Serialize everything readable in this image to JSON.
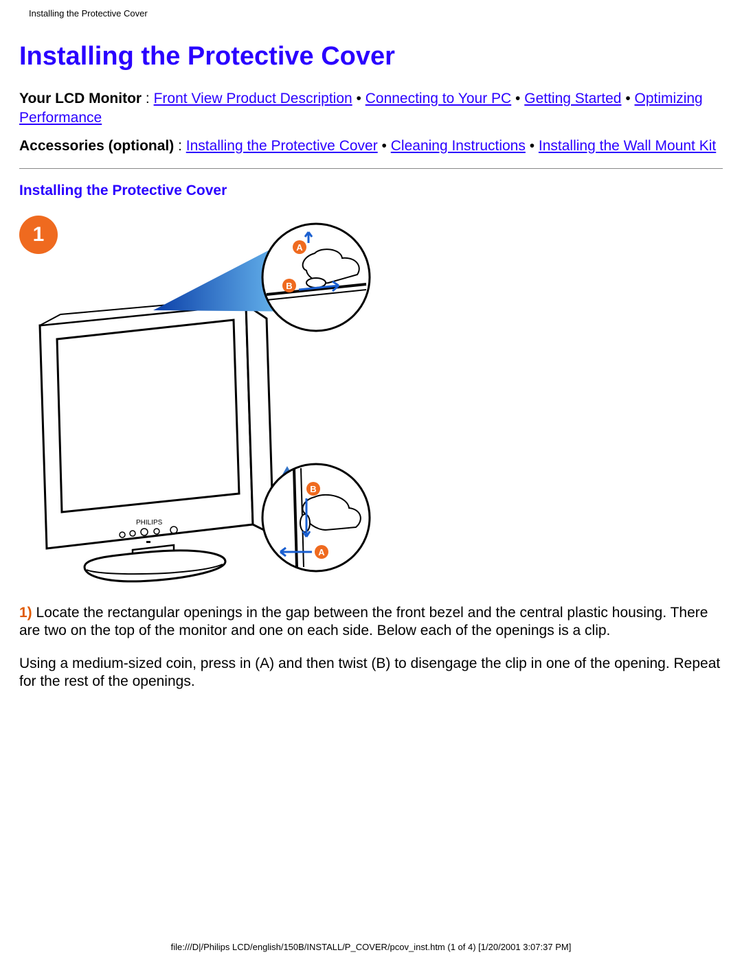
{
  "header": {
    "doc_title_small": "Installing the Protective Cover"
  },
  "page_title": "Installing the Protective Cover",
  "nav1": {
    "label": "Your LCD Monitor",
    "sep": " : ",
    "links": [
      "Front View Product Description",
      "Connecting to Your PC",
      "Getting Started",
      "Optimizing Performance"
    ]
  },
  "nav2": {
    "label": "Accessories (optional)",
    "sep": " : ",
    "links": [
      "Installing the Protective Cover",
      "Cleaning Instructions",
      "Installing the Wall Mount Kit"
    ]
  },
  "bullet": " • ",
  "section_title": "Installing the Protective Cover",
  "step_badge": "1",
  "step1": {
    "num": "1)",
    "text": " Locate the rectangular openings in the gap between the front bezel and the central plastic housing. There are two on the top of the monitor and one on each side. Below each of the openings is a clip."
  },
  "step1b": "Using a medium-sized coin, press in (A) and then twist (B) to disengage the clip in one of the opening. Repeat for the rest of the openings.",
  "footer": "file:///D|/Philips LCD/english/150B/INSTALL/P_COVER/pcov_inst.htm (1 of 4) [1/20/2001 3:07:37 PM]",
  "diagram": {
    "callout_labels": {
      "a": "A",
      "b": "B"
    },
    "brand_text": "PHILIPS"
  }
}
